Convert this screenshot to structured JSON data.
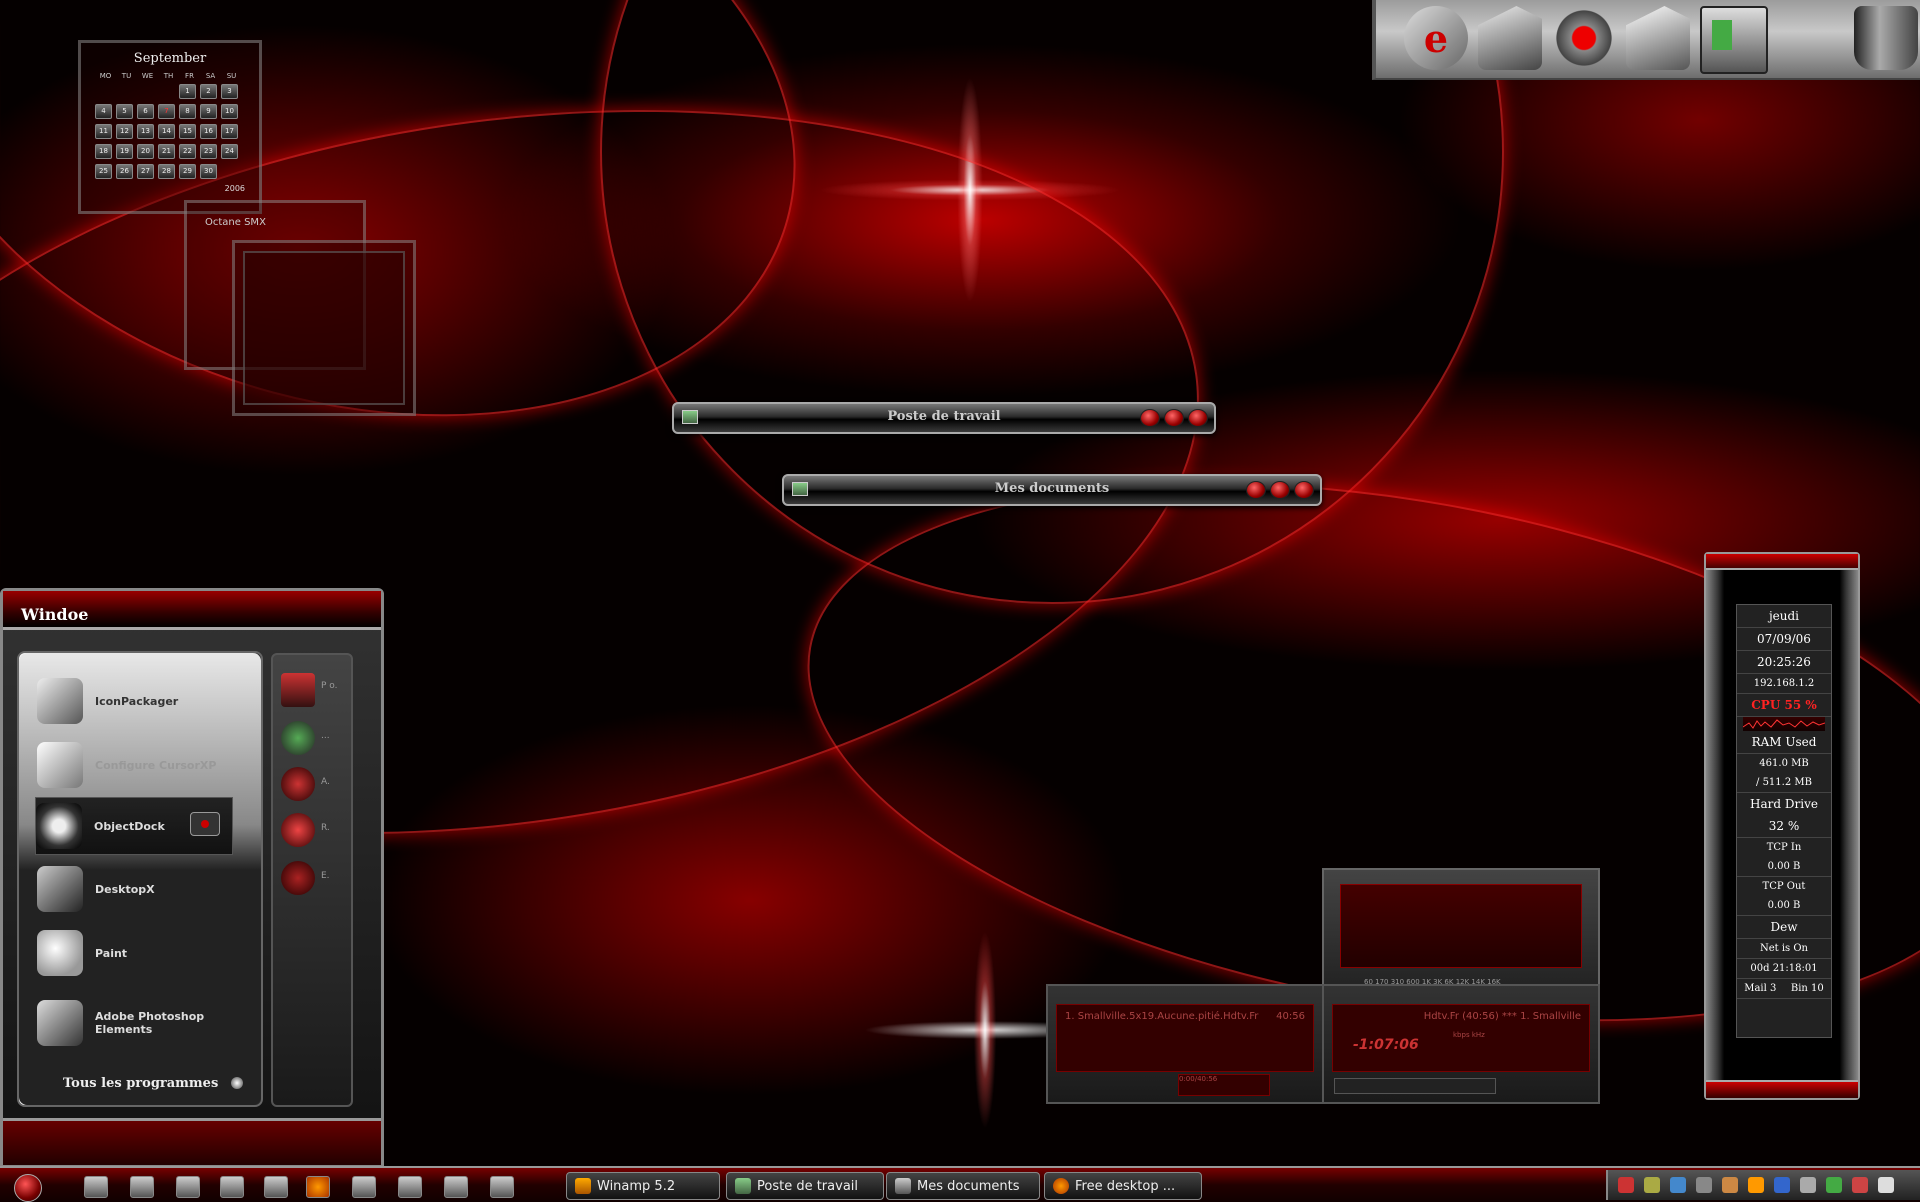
{
  "calendar": {
    "month": "September",
    "weekdays": [
      "MO",
      "TU",
      "WE",
      "TH",
      "FR",
      "SA",
      "SU"
    ],
    "days": [
      "",
      "",
      "",
      "",
      "1",
      "2",
      "3",
      "4",
      "5",
      "6",
      "7",
      "8",
      "9",
      "10",
      "11",
      "12",
      "13",
      "14",
      "15",
      "16",
      "17",
      "18",
      "19",
      "20",
      "21",
      "22",
      "23",
      "24",
      "25",
      "26",
      "27",
      "28",
      "29",
      "30",
      ""
    ],
    "today": "7",
    "year": "2006"
  },
  "octane": {
    "label": "Octane SMX"
  },
  "windows": {
    "poste": {
      "title": "Poste de travail"
    },
    "docs": {
      "title": "Mes documents"
    }
  },
  "startmenu": {
    "user": "Windoe",
    "programs": [
      {
        "label": "IconPackager",
        "icon": "iconpackager-icon"
      },
      {
        "label": "Configure CursorXP",
        "icon": "cursorxp-icon"
      },
      {
        "label": "ObjectDock",
        "icon": "objectdock-icon"
      },
      {
        "label": "DesktopX",
        "icon": "desktopx-icon"
      },
      {
        "label": "Paint",
        "icon": "paint-icon"
      },
      {
        "label": "Adobe Photoshop Elements",
        "icon": "photoshop-icon"
      }
    ],
    "all_programs": "Tous les programmes",
    "right_items": [
      {
        "label": "P o.",
        "icon": "computer-icon"
      },
      {
        "label": "...",
        "icon": "network-icon"
      },
      {
        "label": "A.",
        "icon": "help-icon"
      },
      {
        "label": "R.",
        "icon": "search-icon"
      },
      {
        "label": "E.",
        "icon": "run-icon"
      }
    ]
  },
  "sysmeter": {
    "day": "jeudi",
    "date": "07/09/06",
    "time": "20:25:26",
    "ip": "192.168.1.2",
    "cpu": "CPU 55 %",
    "ram_label": "RAM Used",
    "ram_used": "461.0 MB",
    "ram_total": "/ 511.2 MB",
    "hd_label": "Hard Drive",
    "hd_value": "32 %",
    "tcp_in_label": "TCP In",
    "tcp_in": "0.00 B",
    "tcp_out_label": "TCP Out",
    "tcp_out": "0.00 B",
    "user": "Dew",
    "net": "Net is On",
    "uptime": "00d 21:18:01",
    "mail": "Mail 3",
    "bin": "Bin 10"
  },
  "winamp": {
    "playlist_track": "1. Smallville.5x19.Aucune.pitié.Hdtv.Fr",
    "playlist_duration": "40:56",
    "playlist_time": "0:00/40:56",
    "main_track": "Hdtv.Fr (40:56) *** 1. Smallville",
    "main_kbps": "kbps  kHz",
    "main_elapsed": "-1:07:06",
    "eq_freqs": "60  170  310  600  1K  3K  6K  12K  14K  16K"
  },
  "taskbar": {
    "tasks": [
      {
        "label": "Winamp 5.2",
        "icon": "winamp-icon"
      },
      {
        "label": "Poste de travail",
        "icon": "computer-icon"
      },
      {
        "label": "Mes documents",
        "icon": "folder-icon"
      },
      {
        "label": "Free desktop ...",
        "icon": "firefox-icon"
      }
    ]
  },
  "colors": {
    "accent": "#cc0000",
    "chrome": "#888888"
  }
}
